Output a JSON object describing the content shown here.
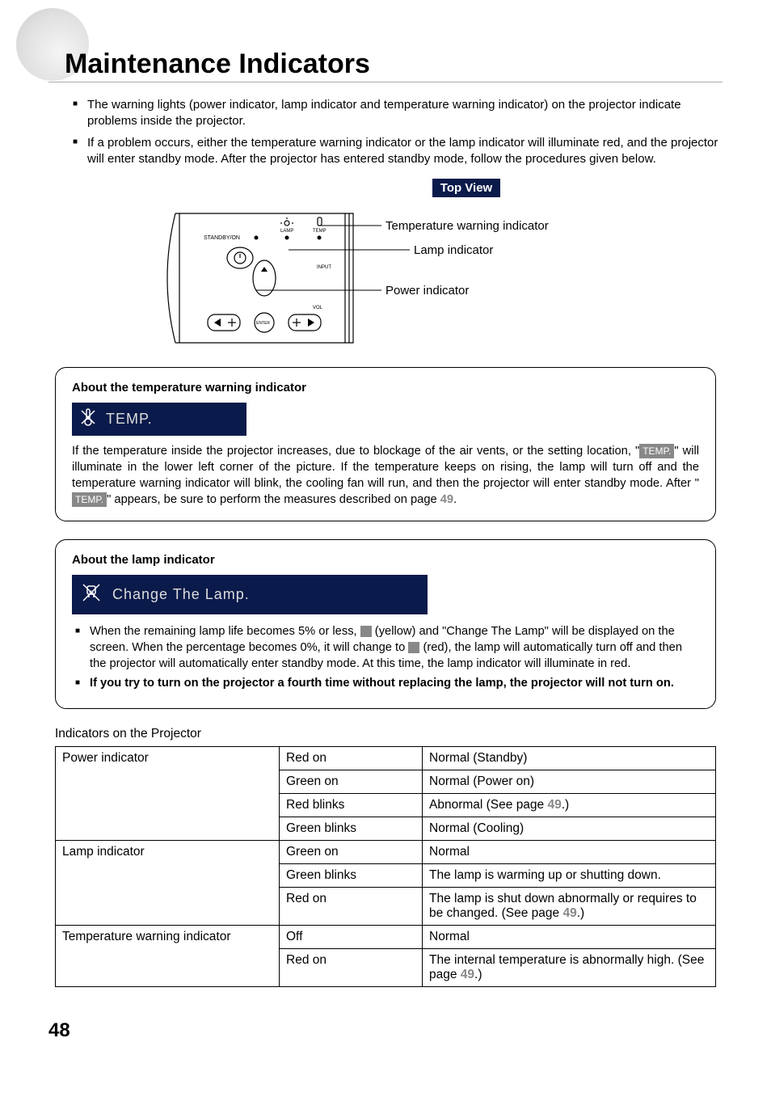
{
  "title": "Maintenance Indicators",
  "intro": {
    "item1": "The warning lights (power indicator, lamp indicator and temperature warning indicator) on the projector indicate problems inside the projector.",
    "item2": "If a problem occurs, either the temperature warning indicator or the lamp indicator will illuminate red, and the projector will enter standby mode. After the projector has entered standby mode, follow the procedures given below."
  },
  "topview": {
    "label": "Top View",
    "callout1": "Temperature warning indicator",
    "callout2": "Lamp indicator",
    "callout3": "Power indicator",
    "panel": {
      "standby": "STANDBY/ON",
      "lamp": "LAMP",
      "temp": "TEMP",
      "input": "INPUT",
      "vol": "VOL",
      "enter": "ENTER"
    }
  },
  "temp_section": {
    "heading": "About the temperature warning indicator",
    "osd": "TEMP.",
    "body_before_badge1": "If the temperature inside the projector increases, due to blockage of the air vents, or the setting location, \"",
    "badge1": "TEMP.",
    "body_mid": "\" will illuminate in the lower left corner of the picture. If the temperature keeps on rising, the lamp will turn off and the temperature warning indicator will blink, the cooling fan will run, and then the projector will enter standby mode. After \"",
    "badge2": "TEMP.",
    "body_after": "\" appears, be sure to perform the measures described on page ",
    "pageref": "49",
    "body_end": "."
  },
  "lamp_section": {
    "heading": "About the lamp indicator",
    "osd": "Change The Lamp.",
    "b1_a": "When the remaining lamp life becomes 5% or less, ",
    "b1_y": "(yellow)",
    "b1_b": " and \"Change The Lamp\" will be displayed on the screen. When the percentage becomes 0%, it will change to ",
    "b1_r": "(red)",
    "b1_c": ", the lamp will automatically turn off and then the projector will automatically enter standby mode. At this time, the lamp indicator will illuminate in red.",
    "b2": "If you try to turn on the projector a fourth time without replacing the lamp, the projector will not turn on."
  },
  "table": {
    "caption": "Indicators on the Projector",
    "rows": [
      {
        "ind": "Power indicator",
        "state": "Red on",
        "meaning": "Normal (Standby)"
      },
      {
        "state": "Green on",
        "meaning": "Normal (Power on)"
      },
      {
        "state": "Red blinks",
        "meaning_a": "Abnormal (See page ",
        "pageref": "49",
        "meaning_b": ".)"
      },
      {
        "state": "Green blinks",
        "meaning": "Normal (Cooling)"
      },
      {
        "ind": "Lamp indicator",
        "state": "Green on",
        "meaning": "Normal"
      },
      {
        "state": "Green blinks",
        "meaning": "The lamp is warming up or shutting down."
      },
      {
        "state": "Red on",
        "meaning_a": "The lamp is shut down abnormally or requires to be changed. (See page ",
        "pageref": "49",
        "meaning_b": ".)"
      },
      {
        "ind": "Temperature warning indicator",
        "state": "Off",
        "meaning": "Normal"
      },
      {
        "state": "Red on",
        "meaning_a": "The internal temperature is abnormally high. (See page ",
        "pageref": "49",
        "meaning_b": ".)"
      }
    ]
  },
  "pagenum": "48"
}
